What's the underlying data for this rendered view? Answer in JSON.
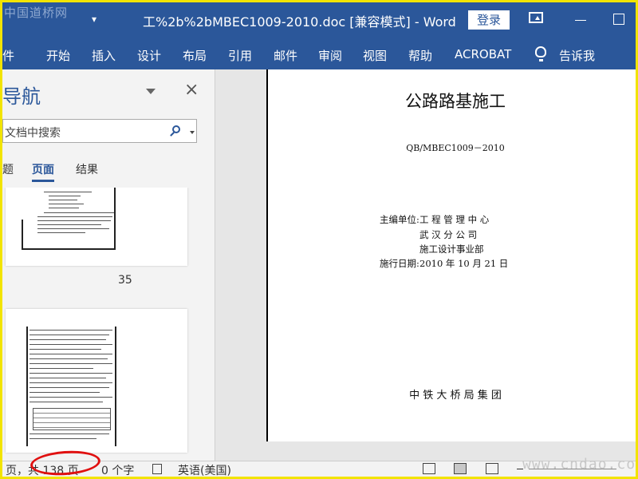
{
  "app": {
    "watermark_top": "中国道桥网",
    "doc_title": "工%2b%2bMBEC1009-2010.doc [兼容模式]  -  Word",
    "login": "登录",
    "qat_arrow": "▾"
  },
  "ribbon": {
    "tabs": [
      "件",
      "开始",
      "插入",
      "设计",
      "布局",
      "引用",
      "邮件",
      "审阅",
      "视图",
      "帮助",
      "ACROBAT"
    ],
    "tell_me": "告诉我"
  },
  "nav": {
    "title": "导航",
    "search_placeholder": "文档中搜索",
    "tabs": [
      "题",
      "页面",
      "结果"
    ],
    "page_numbers": [
      "35"
    ]
  },
  "document": {
    "title": "公路路基施工",
    "code": "QB/MBEC1009－2010",
    "editor_label": "主编单位:",
    "editor_lines": [
      "工 程 管 理 中 心",
      "武 汉 分 公 司",
      "施工设计事业部"
    ],
    "date_label": "施行日期:",
    "date_value": "2010 年 10 月 21 日",
    "publisher": "中 铁 大 桥 局 集 团"
  },
  "status": {
    "page_info": "页，共 138 页",
    "word_count": "0 个字",
    "language": "英语(美国)",
    "watermark_bottom": "www.cndao.com"
  }
}
